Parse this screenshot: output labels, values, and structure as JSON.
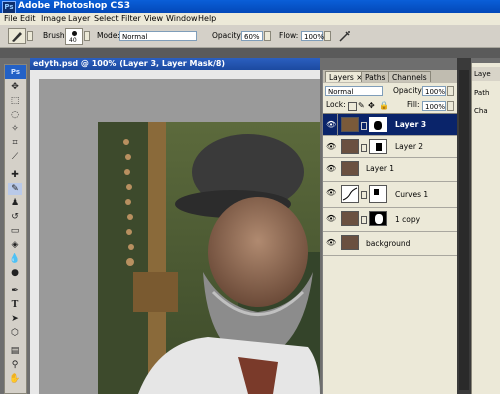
{
  "app": {
    "title": "Adobe Photoshop CS3",
    "logo": "Ps"
  },
  "menu": [
    "File",
    "Edit",
    "Image",
    "Layer",
    "Select",
    "Filter",
    "View",
    "Window",
    "Help"
  ],
  "options": {
    "brush_label": "Brush:",
    "brush_size": "40",
    "mode_label": "Mode:",
    "mode_value": "Normal",
    "opacity_label": "Opacity:",
    "opacity_value": "60%",
    "flow_label": "Flow:",
    "flow_value": "100%"
  },
  "document": {
    "tab_title": "edyth.psd @ 100% (Layer 3, Layer Mask/8)"
  },
  "layers_panel": {
    "tabs": [
      "Layers",
      "Paths",
      "Channels"
    ],
    "tab_close": "×",
    "blend_mode": "Normal",
    "opacity_label": "Opacity:",
    "opacity_value": "100%",
    "lock_label": "Lock:",
    "fill_label": "Fill:",
    "fill_value": "100%",
    "layers": [
      {
        "name": "Layer 3",
        "selected": true
      },
      {
        "name": "Layer 2",
        "selected": false
      },
      {
        "name": "Layer 1",
        "selected": false
      },
      {
        "name": "Curves 1",
        "selected": false
      },
      {
        "name": "1 copy",
        "selected": false
      },
      {
        "name": "background",
        "selected": false
      }
    ]
  },
  "right_panel": [
    "Laye",
    "Path",
    "Cha"
  ],
  "colors": {
    "titlebar": "#0a5fd8",
    "selection": "#0a246a"
  }
}
